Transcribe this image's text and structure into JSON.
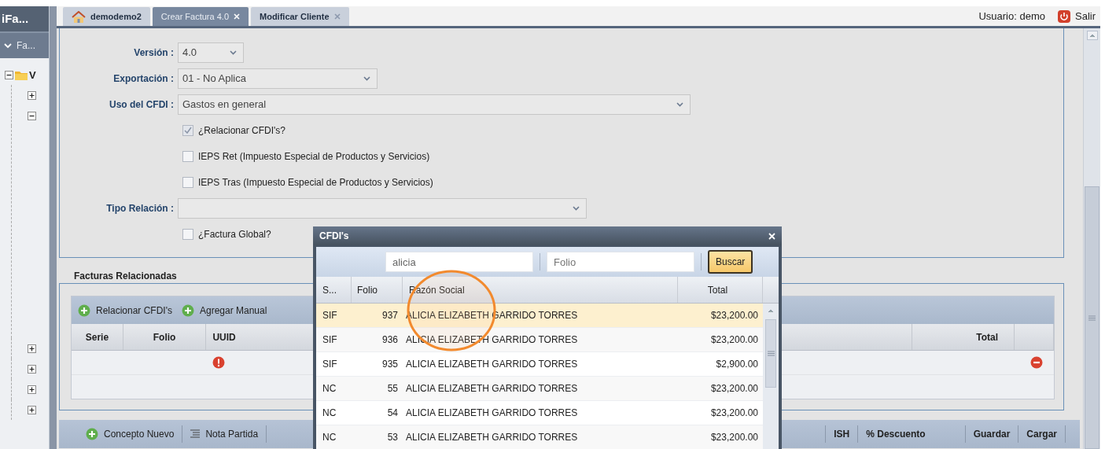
{
  "sidebar": {
    "title": "iFa...",
    "section": "Fa...",
    "tree": [
      {
        "label": "V",
        "expanded": true,
        "children": [
          {
            "expanded": false
          },
          {
            "expanded": true
          }
        ]
      }
    ],
    "more_nodes": [
      {
        "expanded": false
      },
      {
        "expanded": false
      },
      {
        "expanded": false
      },
      {
        "expanded": false
      }
    ]
  },
  "tabs": [
    {
      "label": "demodemo2",
      "kind": "home",
      "closable": false,
      "selected": false
    },
    {
      "label": "Crear Factura 4.0",
      "kind": "plain",
      "closable": true,
      "selected": true
    },
    {
      "label": "Modificar Cliente",
      "kind": "plain",
      "closable": true,
      "selected": false
    }
  ],
  "user": {
    "label": "Usuario: demo",
    "logout": "Salir"
  },
  "form": {
    "rows": [
      {
        "kind": "select",
        "label": "Versión :",
        "value": "4.0"
      },
      {
        "kind": "select",
        "label": "Exportación :",
        "value": "01 - No Aplica"
      },
      {
        "kind": "select",
        "label": "Uso del CFDI :",
        "value": "Gastos en general"
      },
      {
        "kind": "checkbox",
        "label": "¿Relacionar CFDI's?",
        "checked": true
      },
      {
        "kind": "checkbox",
        "label": "IEPS Ret (Impuesto Especial de Productos y Servicios)",
        "checked": false
      },
      {
        "kind": "checkbox",
        "label": "IEPS Tras (Impuesto Especial de Productos y Servicios)",
        "checked": false
      },
      {
        "kind": "select",
        "label": "Tipo Relación :"
      },
      {
        "kind": "checkbox",
        "label": "¿Factura Global?",
        "checked": false
      }
    ]
  },
  "related": {
    "title": "Facturas Relacionadas",
    "toolbar": [
      "Relacionar CFDI's",
      "Agregar Manual"
    ],
    "columns": [
      "Serie",
      "Folio",
      "UUID",
      "Total"
    ],
    "rows": [
      {
        "warning": true,
        "removable": true
      }
    ]
  },
  "concepts_toolbar": {
    "left": [
      {
        "label": "Concepto Nuevo",
        "kind": "add"
      },
      {
        "label": "Nota Partida",
        "kind": "list"
      }
    ],
    "right": [
      "ISH",
      "% Descuento",
      "Guardar",
      "Cargar"
    ]
  },
  "dialog": {
    "title": "CFDI's",
    "search": {
      "value": "alicia"
    },
    "folio": {
      "placeholder": "Folio"
    },
    "button": "Buscar",
    "columns": [
      "S...",
      "Folio",
      "Razón Social",
      "Total"
    ],
    "rows": [
      {
        "serie": "SIF",
        "folio": "937",
        "name": "ALICIA ELIZABETH GARRIDO TORRES",
        "total": "$23,200.00",
        "selected": true
      },
      {
        "serie": "SIF",
        "folio": "936",
        "name": "ALICIA ELIZABETH GARRIDO TORRES",
        "total": "$23,200.00",
        "selected": false
      },
      {
        "serie": "SIF",
        "folio": "935",
        "name": "ALICIA ELIZABETH GARRIDO TORRES",
        "total": "$2,900.00",
        "selected": false
      },
      {
        "serie": "NC",
        "folio": "55",
        "name": "ALICIA ELIZABETH GARRIDO TORRES",
        "total": "$23,200.00",
        "selected": false
      },
      {
        "serie": "NC",
        "folio": "54",
        "name": "ALICIA ELIZABETH GARRIDO TORRES",
        "total": "$23,200.00",
        "selected": false
      },
      {
        "serie": "NC",
        "folio": "53",
        "name": "ALICIA ELIZABETH GARRIDO TORRES",
        "total": "$23,200.00",
        "selected": false
      }
    ]
  }
}
